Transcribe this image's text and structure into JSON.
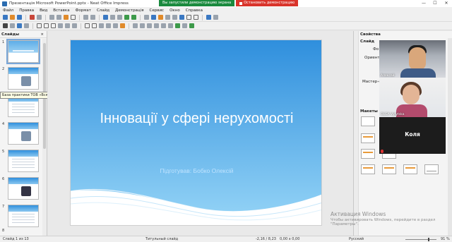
{
  "window": {
    "title": "Презентація Microsoft PowerPoint.pptx - Neat Office Impress",
    "share_status": "Вы запустили демонстрацию экрана",
    "share_stop": "Остановить демонстрацию",
    "controls": [
      "—",
      "☐",
      "✕"
    ]
  },
  "menu": [
    "Файл",
    "Правка",
    "Вид",
    "Вставка",
    "Формат",
    "Слайд",
    "Демонстрація",
    "Сервис",
    "Окно",
    "Справка"
  ],
  "slides_panel": {
    "title": "Слайды",
    "close": "×",
    "numbers": [
      "1",
      "2",
      "3",
      "4",
      "5",
      "6",
      "7",
      "8"
    ]
  },
  "tooltip": "База практики ТОВ «Вся Нерухомість України»",
  "slide": {
    "title": "Інновації у сфері нерухомості",
    "subtitle": "Підготував: Бобко Олексій",
    "colors": {
      "top": "#2f8fdd",
      "bottom": "#8fd0f5"
    }
  },
  "sidebar": {
    "title": "Свойства",
    "section_slide": "Слайд",
    "format_label": "Фо",
    "orientation_label": "Ориенти",
    "master_label": "Мастер-сл",
    "section_masters": "Макеты"
  },
  "video": {
    "p1": "Алексей",
    "p2": "OLGA Vytytska",
    "p3": "Коля"
  },
  "watermark": {
    "line1": "Активация Windows",
    "line2": "Чтобы активировать Windows, перейдите в раздел \"Параметры\"."
  },
  "status": {
    "slide_info": "Слайд 1 из 13",
    "layout": "Титульный слайд",
    "position": "-2,16 / 8,23",
    "size": "0,00 x 0,00",
    "language": "Русский",
    "zoom": "91 %"
  }
}
